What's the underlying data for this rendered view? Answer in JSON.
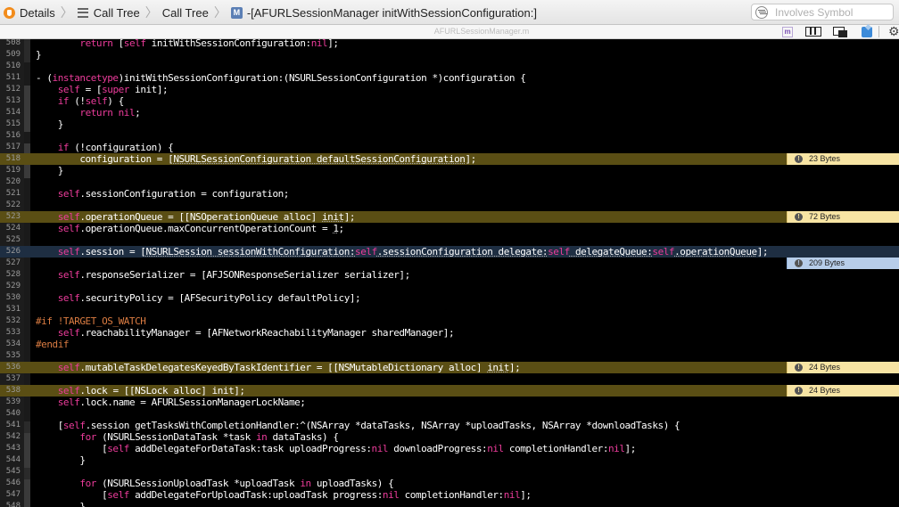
{
  "toolbar": {
    "breadcrumbs": [
      {
        "label": "Details",
        "icon": "instruments-detail-icon"
      },
      {
        "label": "Call Tree",
        "icon": "call-tree-list-icon"
      },
      {
        "label": "Call Tree",
        "icon": ""
      },
      {
        "label": "-[AFURLSessionManager initWithSessionConfiguration:]",
        "icon": "objc-method-icon",
        "icon_text": "M"
      }
    ],
    "filter_placeholder": "Involves Symbol"
  },
  "jumpbar": {
    "filename": "AFURLSessionManager.m",
    "m_label": "m"
  },
  "editor": {
    "lines": [
      {
        "n": "508",
        "style": "",
        "segs": [
          [
            "        ",
            ""
          ],
          [
            "return",
            "kw"
          ],
          [
            " [",
            ""
          ],
          [
            "self",
            "kw"
          ],
          [
            " initWithSessionConfiguration:",
            ""
          ],
          [
            "nil",
            "kw"
          ],
          [
            "];",
            ""
          ]
        ]
      },
      {
        "n": "509",
        "style": "",
        "segs": [
          [
            "}",
            ""
          ]
        ]
      },
      {
        "n": "510",
        "style": "",
        "segs": []
      },
      {
        "n": "511",
        "style": "",
        "segs": [
          [
            "- (",
            ""
          ],
          [
            "instancetype",
            "kw"
          ],
          [
            ")initWithSessionConfiguration:(NSURLSessionConfiguration *)configuration {",
            ""
          ]
        ]
      },
      {
        "n": "512",
        "style": "",
        "segs": [
          [
            "    ",
            ""
          ],
          [
            "self",
            "kw"
          ],
          [
            " = [",
            ""
          ],
          [
            "super",
            "kw"
          ],
          [
            " init];",
            ""
          ]
        ]
      },
      {
        "n": "513",
        "style": "",
        "segs": [
          [
            "    ",
            ""
          ],
          [
            "if",
            "kw"
          ],
          [
            " (!",
            ""
          ],
          [
            "self",
            "kw"
          ],
          [
            ") {",
            ""
          ]
        ]
      },
      {
        "n": "514",
        "style": "",
        "segs": [
          [
            "        ",
            ""
          ],
          [
            "return",
            "kw"
          ],
          [
            " ",
            ""
          ],
          [
            "nil",
            "kw"
          ],
          [
            ";",
            ""
          ]
        ]
      },
      {
        "n": "515",
        "style": "",
        "segs": [
          [
            "    }",
            ""
          ]
        ]
      },
      {
        "n": "516",
        "style": "",
        "segs": []
      },
      {
        "n": "517",
        "style": "",
        "segs": [
          [
            "    ",
            ""
          ],
          [
            "if",
            "kw"
          ],
          [
            " (!configuration) {",
            ""
          ]
        ]
      },
      {
        "n": "518",
        "style": "hl",
        "badge": "23 Bytes",
        "segs": [
          [
            "        configuration = [",
            ""
          ],
          [
            "NSURLSessionConfiguration defaultSessionConfiguration",
            "u"
          ],
          [
            "];",
            ""
          ]
        ]
      },
      {
        "n": "519",
        "style": "",
        "segs": [
          [
            "    }",
            ""
          ]
        ]
      },
      {
        "n": "520",
        "style": "",
        "segs": []
      },
      {
        "n": "521",
        "style": "",
        "segs": [
          [
            "    ",
            ""
          ],
          [
            "self",
            "kw"
          ],
          [
            ".sessionConfiguration = configuration;",
            ""
          ]
        ]
      },
      {
        "n": "522",
        "style": "",
        "segs": []
      },
      {
        "n": "523",
        "style": "hl",
        "badge": "72 Bytes",
        "segs": [
          [
            "    ",
            ""
          ],
          [
            "self",
            "kw"
          ],
          [
            ".operationQueue = [[NSOperationQueue alloc] ",
            ""
          ],
          [
            "init",
            "u"
          ],
          [
            "];",
            ""
          ]
        ]
      },
      {
        "n": "524",
        "style": "",
        "segs": [
          [
            "    ",
            ""
          ],
          [
            "self",
            "kw"
          ],
          [
            ".operationQueue.maxConcurrentOperationCount = ",
            ""
          ],
          [
            "1",
            "u"
          ],
          [
            ";",
            ""
          ]
        ]
      },
      {
        "n": "525",
        "style": "",
        "segs": []
      },
      {
        "n": "526",
        "style": "sel",
        "badge": "209 Bytes",
        "badge_style": "blue",
        "segs": [
          [
            "    ",
            ""
          ],
          [
            "self",
            "kw"
          ],
          [
            ".session = [",
            ""
          ],
          [
            "NSURLSession sessionWithConfiguration:",
            "u"
          ],
          [
            "self",
            "kw"
          ],
          [
            ".sessionConfiguration delegate:",
            "u"
          ],
          [
            "self",
            "kw"
          ],
          [
            " delegateQueue:",
            "u"
          ],
          [
            "self",
            "kw"
          ],
          [
            ".operationQueue",
            "u"
          ],
          [
            "];",
            ""
          ]
        ]
      },
      {
        "n": "527",
        "style": "",
        "segs": []
      },
      {
        "n": "528",
        "style": "",
        "segs": [
          [
            "    ",
            ""
          ],
          [
            "self",
            "kw"
          ],
          [
            ".responseSerializer = [AFJSONResponseSerializer serializer];",
            ""
          ]
        ]
      },
      {
        "n": "529",
        "style": "",
        "segs": []
      },
      {
        "n": "530",
        "style": "",
        "segs": [
          [
            "    ",
            ""
          ],
          [
            "self",
            "kw"
          ],
          [
            ".securityPolicy = [AFSecurityPolicy defaultPolicy];",
            ""
          ]
        ]
      },
      {
        "n": "531",
        "style": "",
        "segs": []
      },
      {
        "n": "532",
        "style": "",
        "segs": [
          [
            "#if !TARGET_OS_WATCH",
            "pp"
          ]
        ]
      },
      {
        "n": "533",
        "style": "",
        "segs": [
          [
            "    ",
            ""
          ],
          [
            "self",
            "kw"
          ],
          [
            ".reachabilityManager = [AFNetworkReachabilityManager sharedManager];",
            ""
          ]
        ]
      },
      {
        "n": "534",
        "style": "",
        "segs": [
          [
            "#endif",
            "pp"
          ]
        ]
      },
      {
        "n": "535",
        "style": "",
        "segs": []
      },
      {
        "n": "536",
        "style": "hl",
        "badge": "24 Bytes",
        "segs": [
          [
            "    ",
            ""
          ],
          [
            "self",
            "kw"
          ],
          [
            ".mutableTaskDelegatesKeyedByTaskIdentifier = [[NSMutableDictionary alloc] ",
            ""
          ],
          [
            "init",
            "u"
          ],
          [
            "];",
            ""
          ]
        ]
      },
      {
        "n": "537",
        "style": "",
        "segs": []
      },
      {
        "n": "538",
        "style": "hl",
        "badge": "24 Bytes",
        "segs": [
          [
            "    ",
            ""
          ],
          [
            "self",
            "kw"
          ],
          [
            ".lock = [[NSLock alloc] init];",
            ""
          ]
        ]
      },
      {
        "n": "539",
        "style": "",
        "segs": [
          [
            "    ",
            ""
          ],
          [
            "self",
            "kw"
          ],
          [
            ".lock.name = AFURLSessionManagerLockName;",
            ""
          ]
        ]
      },
      {
        "n": "540",
        "style": "",
        "segs": []
      },
      {
        "n": "541",
        "style": "",
        "segs": [
          [
            "    [",
            ""
          ],
          [
            "self",
            "kw"
          ],
          [
            ".session getTasksWithCompletionHandler:^(NSArray *dataTasks, NSArray *uploadTasks, NSArray *downloadTasks) {",
            ""
          ]
        ]
      },
      {
        "n": "542",
        "style": "",
        "segs": [
          [
            "        ",
            ""
          ],
          [
            "for",
            "kw"
          ],
          [
            " (NSURLSessionDataTask *task ",
            ""
          ],
          [
            "in",
            "kw"
          ],
          [
            " dataTasks) {",
            ""
          ]
        ]
      },
      {
        "n": "543",
        "style": "",
        "segs": [
          [
            "            [",
            ""
          ],
          [
            "self",
            "kw"
          ],
          [
            " addDelegateForDataTask:task uploadProgress:",
            ""
          ],
          [
            "nil",
            "kw"
          ],
          [
            " downloadProgress:",
            ""
          ],
          [
            "nil",
            "kw"
          ],
          [
            " completionHandler:",
            ""
          ],
          [
            "nil",
            "kw"
          ],
          [
            "];",
            ""
          ]
        ]
      },
      {
        "n": "544",
        "style": "",
        "segs": [
          [
            "        }",
            ""
          ]
        ]
      },
      {
        "n": "545",
        "style": "",
        "segs": []
      },
      {
        "n": "546",
        "style": "",
        "segs": [
          [
            "        ",
            ""
          ],
          [
            "for",
            "kw"
          ],
          [
            " (NSURLSessionUploadTask *uploadTask ",
            ""
          ],
          [
            "in",
            "kw"
          ],
          [
            " uploadTasks) {",
            ""
          ]
        ]
      },
      {
        "n": "547",
        "style": "",
        "segs": [
          [
            "            [",
            ""
          ],
          [
            "self",
            "kw"
          ],
          [
            " addDelegateForUploadTask:uploadTask progress:",
            ""
          ],
          [
            "nil",
            "kw"
          ],
          [
            " completionHandler:",
            ""
          ],
          [
            "nil",
            "kw"
          ],
          [
            "];",
            ""
          ]
        ]
      },
      {
        "n": "548",
        "style": "",
        "segs": [
          [
            "        }",
            ""
          ]
        ]
      }
    ]
  }
}
